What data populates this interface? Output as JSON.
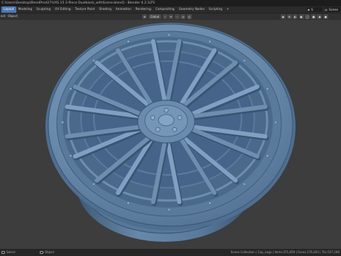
{
  "window": {
    "title": "C:\\Users\\Desktop\\BlendProd27\\VXS 15 2-Piece Dualblock_withScene.blend] - Blender 4.2.1LTS"
  },
  "workspace_tabs": [
    {
      "label": "Layout",
      "active": true
    },
    {
      "label": "Modeling",
      "active": false
    },
    {
      "label": "Sculpting",
      "active": false
    },
    {
      "label": "UV Editing",
      "active": false
    },
    {
      "label": "Texture Paint",
      "active": false
    },
    {
      "label": "Shading",
      "active": false
    },
    {
      "label": "Animation",
      "active": false
    },
    {
      "label": "Rendering",
      "active": false
    },
    {
      "label": "Compositing",
      "active": false
    },
    {
      "label": "Geometry Nodes",
      "active": false
    },
    {
      "label": "Scripting",
      "active": false
    },
    {
      "label": "+",
      "active": false
    }
  ],
  "scene_selector": {
    "icon": "scene-icon",
    "value": "S"
  },
  "view_layer_selector": {
    "icon": "view-layer-icon",
    "value": "Scene"
  },
  "viewport_header": {
    "menus": [
      "ect",
      "Object"
    ],
    "orientation_label": "Global",
    "orientation_icon": "transform-orientation-icon",
    "pivot_icon": "pivot-point-icon",
    "snap_icon": "snap-icon",
    "proportional_icon": "proportional-edit-icon"
  },
  "statusbar": {
    "left_label": "Select",
    "middle_label": "Object",
    "stats": "Scene Collection | Cap_Logo | Verts:371,659 | Faces:176,263 | Tris:527,166"
  },
  "colors": {
    "viewport_bg": "#3d3d3d",
    "wheel_main": "#6c8cae",
    "wheel_dark": "#3f5a78",
    "wheel_light": "#8caac8",
    "accent_tab": "#4a78b4"
  }
}
